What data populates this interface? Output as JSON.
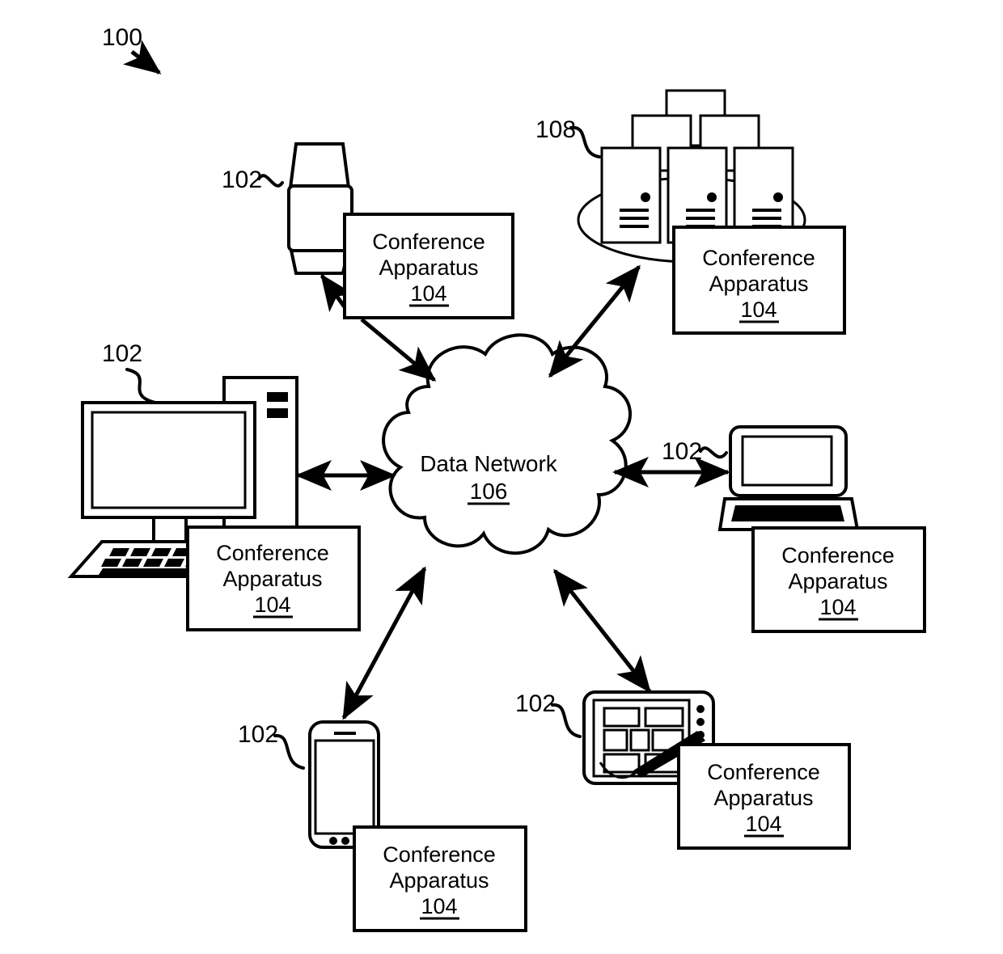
{
  "figure": {
    "figure_number": "100",
    "background_color": "#ffffff",
    "line_color": "#000000"
  },
  "cloud": {
    "label_line1": "Data Network",
    "label_line2": "106"
  },
  "nodes": [
    {
      "id": "smartwatch",
      "device_icon": "smartwatch-icon",
      "ref_label": "102",
      "box_line1": "Conference",
      "box_line2": "Apparatus",
      "box_line3": "104"
    },
    {
      "id": "server-rack",
      "device_icon": "server-rack-icon",
      "ref_label": "108",
      "box_line1": "Conference",
      "box_line2": "Apparatus",
      "box_line3": "104"
    },
    {
      "id": "desktop-computer",
      "device_icon": "desktop-computer-icon",
      "ref_label": "102",
      "box_line1": "Conference",
      "box_line2": "Apparatus",
      "box_line3": "104"
    },
    {
      "id": "laptop",
      "device_icon": "laptop-icon",
      "ref_label": "102",
      "box_line1": "Conference",
      "box_line2": "Apparatus",
      "box_line3": "104"
    },
    {
      "id": "smartphone",
      "device_icon": "smartphone-icon",
      "ref_label": "102",
      "box_line1": "Conference",
      "box_line2": "Apparatus",
      "box_line3": "104"
    },
    {
      "id": "tablet",
      "device_icon": "tablet-stylus-icon",
      "ref_label": "102",
      "box_line1": "Conference",
      "box_line2": "Apparatus",
      "box_line3": "104"
    }
  ],
  "connections": [
    {
      "id": "watch-to-cloud",
      "arrowheads": "single"
    },
    {
      "id": "cloud-to-servers",
      "arrowheads": "double"
    },
    {
      "id": "desktop-to-cloud",
      "arrowheads": "double"
    },
    {
      "id": "cloud-to-laptop",
      "arrowheads": "double"
    },
    {
      "id": "cloud-to-phone",
      "arrowheads": "double"
    },
    {
      "id": "cloud-to-tablet",
      "arrowheads": "double"
    },
    {
      "id": "apparatus-to-watch",
      "arrowheads": "single"
    }
  ]
}
